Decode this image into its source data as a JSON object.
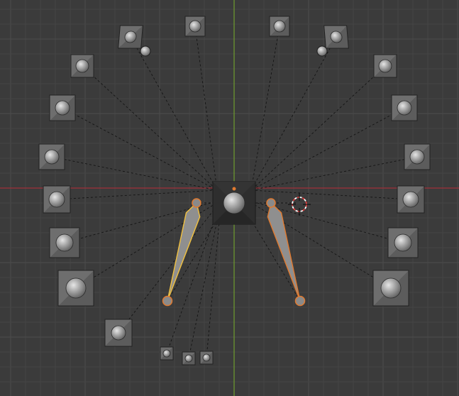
{
  "viewport": {
    "background": "#3b3b3b",
    "grid_minor_color": "#444444",
    "grid_major_color": "#4d4d4d",
    "x_axis_color": "#a0303a",
    "y_axis_color": "#6f9c2e",
    "dashed_line_color": "#141414",
    "controller_box_color": "#2e2e2e",
    "controller_border_color": "#1e1e1e",
    "control_box_fill": "#666666",
    "control_box_border": "#222222",
    "sphere_fill": "#9a9a9a",
    "sphere_highlight": "#e2e2e2",
    "bone_fill": "#8f8f8f",
    "bone_selected_outline": "#f0c040",
    "bone_active_outline": "#e07a30",
    "cursor_red": "#e33b3b",
    "cursor_white": "#ffffff",
    "icons": [
      "3d-cursor-icon",
      "object-origin-icon"
    ]
  }
}
